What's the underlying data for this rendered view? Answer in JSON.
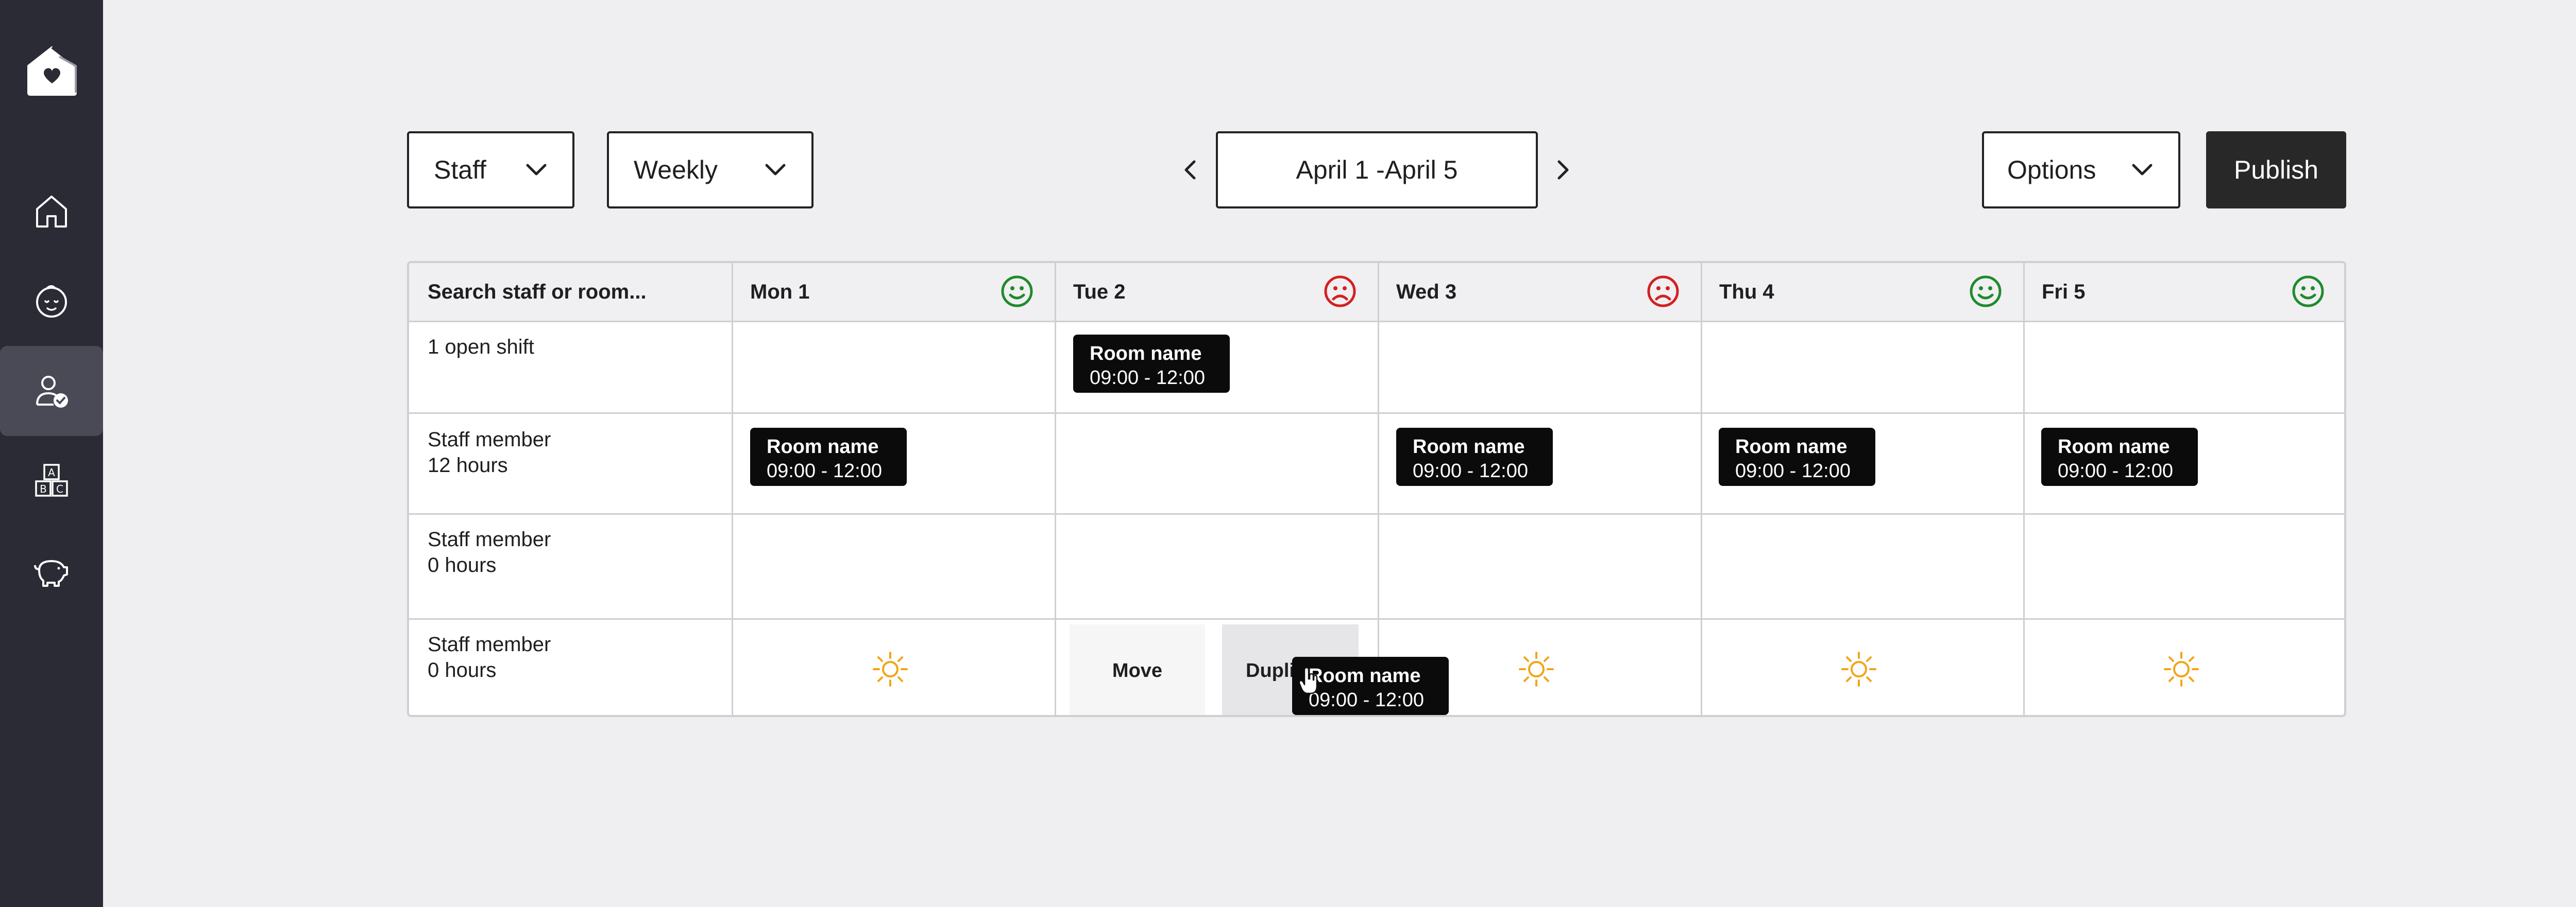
{
  "toolbar": {
    "staff_filter": "Staff",
    "period_filter": "Weekly",
    "date_range": "April 1 -April 5",
    "options_label": "Options",
    "publish_label": "Publish"
  },
  "grid": {
    "search_placeholder": "Search staff or room...",
    "days": [
      {
        "label": "Mon 1",
        "status": "happy"
      },
      {
        "label": "Tue 2",
        "status": "sad"
      },
      {
        "label": "Wed 3",
        "status": "sad"
      },
      {
        "label": "Thu 4",
        "status": "happy"
      },
      {
        "label": "Fri 5",
        "status": "happy"
      }
    ],
    "rows": [
      {
        "line1": "1 open shift",
        "line2": ""
      },
      {
        "line1": "Staff member",
        "line2": "12 hours"
      },
      {
        "line1": "Staff member",
        "line2": "0 hours"
      },
      {
        "line1": "Staff member",
        "line2": "0 hours"
      }
    ],
    "shift": {
      "room": "Room name",
      "time": "09:00 - 12:00"
    },
    "menu": {
      "move": "Move",
      "duplicate": "Dupli"
    }
  },
  "colors": {
    "happy": "#1f8a2c",
    "sad": "#d42020",
    "sun": "#f2a516",
    "sidebar": "#2b2b35"
  },
  "icons": [
    "logo-house-heart-icon",
    "home-icon",
    "child-face-icon",
    "staff-check-icon",
    "abc-blocks-icon",
    "piggy-bank-icon",
    "chevron-down-icon",
    "chevron-left-icon",
    "chevron-right-icon",
    "smiley-icon",
    "frown-icon",
    "sun-icon",
    "hand-cursor-icon"
  ]
}
